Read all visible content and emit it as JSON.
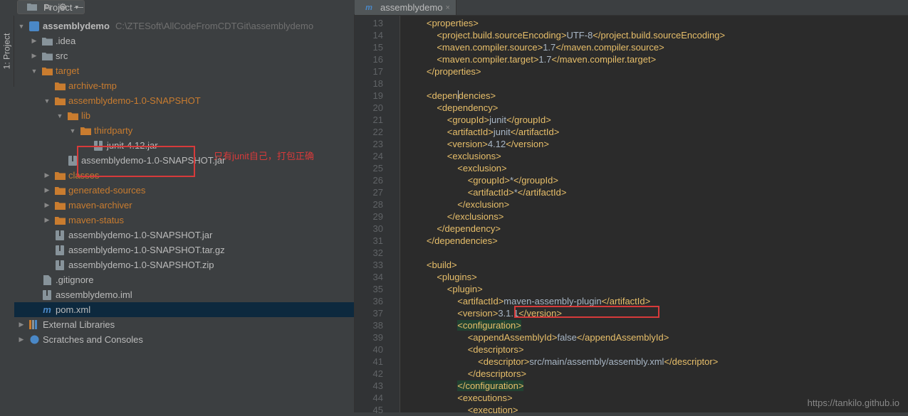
{
  "panel_title": "Project",
  "vertical_tab": "1: Project",
  "root": {
    "name": "assemblydemo",
    "path": "C:\\ZTESoft\\AllCodeFromCDTGit\\assemblydemo"
  },
  "tree": [
    {
      "indent": 1,
      "arrow": "closed",
      "icon": "folder",
      "label": ".idea"
    },
    {
      "indent": 1,
      "arrow": "closed",
      "icon": "folder",
      "label": "src"
    },
    {
      "indent": 1,
      "arrow": "open",
      "icon": "folder-orange",
      "label": "target",
      "orange": true
    },
    {
      "indent": 2,
      "arrow": "none",
      "icon": "folder-orange",
      "label": "archive-tmp",
      "orange": true
    },
    {
      "indent": 2,
      "arrow": "open",
      "icon": "folder-orange",
      "label": "assemblydemo-1.0-SNAPSHOT",
      "orange": true
    },
    {
      "indent": 3,
      "arrow": "open",
      "icon": "folder-orange",
      "label": "lib",
      "orange": true
    },
    {
      "indent": 4,
      "arrow": "open",
      "icon": "folder-orange",
      "label": "thirdparty",
      "orange": true
    },
    {
      "indent": 5,
      "arrow": "none",
      "icon": "archive",
      "label": "junit-4.12.jar"
    },
    {
      "indent": 3,
      "arrow": "none",
      "icon": "archive",
      "label": "assemblydemo-1.0-SNAPSHOT.jar"
    },
    {
      "indent": 2,
      "arrow": "closed",
      "icon": "folder-orange",
      "label": "classes",
      "orange": true
    },
    {
      "indent": 2,
      "arrow": "closed",
      "icon": "folder-orange",
      "label": "generated-sources",
      "orange": true
    },
    {
      "indent": 2,
      "arrow": "closed",
      "icon": "folder-orange",
      "label": "maven-archiver",
      "orange": true
    },
    {
      "indent": 2,
      "arrow": "closed",
      "icon": "folder-orange",
      "label": "maven-status",
      "orange": true
    },
    {
      "indent": 2,
      "arrow": "none",
      "icon": "archive",
      "label": "assemblydemo-1.0-SNAPSHOT.jar"
    },
    {
      "indent": 2,
      "arrow": "none",
      "icon": "archive",
      "label": "assemblydemo-1.0-SNAPSHOT.tar.gz"
    },
    {
      "indent": 2,
      "arrow": "none",
      "icon": "archive",
      "label": "assemblydemo-1.0-SNAPSHOT.zip"
    },
    {
      "indent": 1,
      "arrow": "none",
      "icon": "file",
      "label": ".gitignore"
    },
    {
      "indent": 1,
      "arrow": "none",
      "icon": "archive",
      "label": "assemblydemo.iml"
    },
    {
      "indent": 1,
      "arrow": "none",
      "icon": "maven",
      "label": "pom.xml",
      "selected": true
    }
  ],
  "tree_bottom": [
    {
      "arrow": "closed",
      "icon": "lib",
      "label": "External Libraries"
    },
    {
      "arrow": "closed",
      "icon": "scratch",
      "label": "Scratches and Consoles"
    }
  ],
  "annotation_text": "只有junit自己，打包正确",
  "editor_tab": "assemblydemo",
  "line_start": 13,
  "code_lines": [
    {
      "html": "        <span class='tag'>&lt;properties&gt;</span>"
    },
    {
      "html": "            <span class='tag'>&lt;project.build.sourceEncoding&gt;</span>UTF-8<span class='tag'>&lt;/project.build.sourceEncoding&gt;</span>"
    },
    {
      "html": "            <span class='tag'>&lt;maven.compiler.source&gt;</span>1.7<span class='tag'>&lt;/maven.compiler.source&gt;</span>"
    },
    {
      "html": "            <span class='tag'>&lt;maven.compiler.target&gt;</span>1.7<span class='tag'>&lt;/maven.compiler.target&gt;</span>"
    },
    {
      "html": "        <span class='tag'>&lt;/properties&gt;</span>"
    },
    {
      "html": ""
    },
    {
      "html": "        <span class='tag'>&lt;depen<span style='border-left:1px solid #bbb'>d</span>encies&gt;</span>"
    },
    {
      "html": "            <span class='tag'>&lt;dependency&gt;</span>"
    },
    {
      "html": "                <span class='tag'>&lt;groupId&gt;</span>junit<span class='tag'>&lt;/groupId&gt;</span>"
    },
    {
      "html": "                <span class='tag'>&lt;artifactId&gt;</span>junit<span class='tag'>&lt;/artifactId&gt;</span>"
    },
    {
      "html": "                <span class='tag'>&lt;version&gt;</span>4.12<span class='tag'>&lt;/version&gt;</span>"
    },
    {
      "html": "                <span class='tag'>&lt;exclusions&gt;</span>"
    },
    {
      "html": "                    <span class='tag'>&lt;exclusion&gt;</span>"
    },
    {
      "html": "                        <span class='tag'>&lt;groupId&gt;</span>*<span class='tag'>&lt;/groupId&gt;</span>"
    },
    {
      "html": "                        <span class='tag'>&lt;artifactId&gt;</span>*<span class='tag'>&lt;/artifactId&gt;</span>"
    },
    {
      "html": "                    <span class='tag'>&lt;/exclusion&gt;</span>"
    },
    {
      "html": "                <span class='tag'>&lt;/exclusions&gt;</span>"
    },
    {
      "html": "            <span class='tag'>&lt;/dependency&gt;</span>"
    },
    {
      "html": "        <span class='tag'>&lt;/dependencies&gt;</span>"
    },
    {
      "html": ""
    },
    {
      "html": "        <span class='tag'>&lt;build&gt;</span>"
    },
    {
      "html": "            <span class='tag'>&lt;plugins&gt;</span>"
    },
    {
      "html": "                <span class='tag'>&lt;plugin&gt;</span>"
    },
    {
      "html": "                    <span class='tag'>&lt;artifactId&gt;</span>maven-assembly-plugin<span class='tag'>&lt;/artifactId&gt;</span>"
    },
    {
      "html": "                    <span class='tag'>&lt;version&gt;</span>3.1.1<span class='tag'>&lt;/version&gt;</span>",
      "red_box": true
    },
    {
      "html": "                    <span class='tag hl-green'>&lt;configuration&gt;</span>"
    },
    {
      "html": "                        <span class='tag'>&lt;appendAssemblyId&gt;</span>false<span class='tag'>&lt;/appendAssemblyId&gt;</span>"
    },
    {
      "html": "                        <span class='tag'>&lt;descriptors&gt;</span>"
    },
    {
      "html": "                            <span class='tag'>&lt;descriptor&gt;</span>src/main/assembly/assembly.xml<span class='tag'>&lt;/descriptor&gt;</span>"
    },
    {
      "html": "                        <span class='tag'>&lt;/descriptors&gt;</span>"
    },
    {
      "html": "                    <span class='tag hl-green'>&lt;/configuration&gt;</span>"
    },
    {
      "html": "                    <span class='tag'>&lt;executions&gt;</span>"
    },
    {
      "html": "                        <span class='tag'>&lt;execution&gt;</span>"
    }
  ],
  "watermark": "https://tankilo.github.io"
}
